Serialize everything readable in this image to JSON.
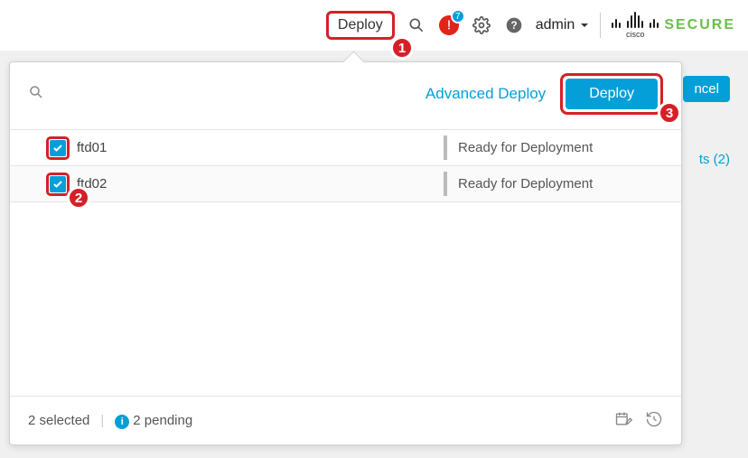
{
  "topbar": {
    "deploy_label": "Deploy",
    "alert_badge": "7",
    "user_label": "admin",
    "brand_secure": "SECURE",
    "brand_cisco": "cisco"
  },
  "background": {
    "cancel_label": "ncel",
    "warrants_label": "ts (2)"
  },
  "panel": {
    "advanced_deploy_label": "Advanced Deploy",
    "deploy_button_label": "Deploy"
  },
  "devices": [
    {
      "name": "ftd01",
      "status": "Ready for Deployment",
      "checked": true
    },
    {
      "name": "ftd02",
      "status": "Ready for Deployment",
      "checked": true
    }
  ],
  "footer": {
    "selected_text": "2 selected",
    "pending_text": "2 pending"
  },
  "callouts": {
    "one": "1",
    "two": "2",
    "three": "3"
  }
}
